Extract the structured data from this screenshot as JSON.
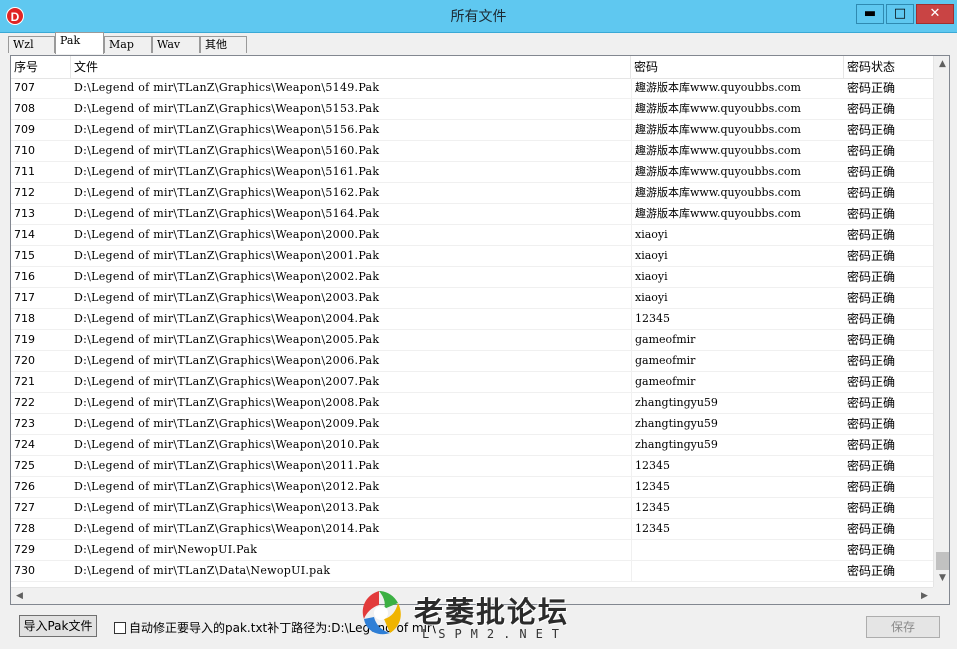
{
  "window": {
    "title": "所有文件",
    "app_icon_letter": "D",
    "min_glyph": "▬",
    "max_glyph": "□",
    "close_glyph": "✕"
  },
  "tabs": [
    {
      "label": "Wzl",
      "active": false
    },
    {
      "label": "Pak",
      "active": true
    },
    {
      "label": "Map",
      "active": false
    },
    {
      "label": "Wav",
      "active": false
    },
    {
      "label": "其他",
      "active": false
    }
  ],
  "table": {
    "columns": {
      "idx": "序号",
      "file": "文件",
      "pwd": "密码",
      "status": "密码状态"
    },
    "rows": [
      {
        "idx": "707",
        "file": "D:\\Legend of mir\\TLanZ\\Graphics\\Weapon\\5149.Pak",
        "pwd": "趣游版本库www.quyoubbs.com",
        "status": "密码正确"
      },
      {
        "idx": "708",
        "file": "D:\\Legend of mir\\TLanZ\\Graphics\\Weapon\\5153.Pak",
        "pwd": "趣游版本库www.quyoubbs.com",
        "status": "密码正确"
      },
      {
        "idx": "709",
        "file": "D:\\Legend of mir\\TLanZ\\Graphics\\Weapon\\5156.Pak",
        "pwd": "趣游版本库www.quyoubbs.com",
        "status": "密码正确"
      },
      {
        "idx": "710",
        "file": "D:\\Legend of mir\\TLanZ\\Graphics\\Weapon\\5160.Pak",
        "pwd": "趣游版本库www.quyoubbs.com",
        "status": "密码正确"
      },
      {
        "idx": "711",
        "file": "D:\\Legend of mir\\TLanZ\\Graphics\\Weapon\\5161.Pak",
        "pwd": "趣游版本库www.quyoubbs.com",
        "status": "密码正确"
      },
      {
        "idx": "712",
        "file": "D:\\Legend of mir\\TLanZ\\Graphics\\Weapon\\5162.Pak",
        "pwd": "趣游版本库www.quyoubbs.com",
        "status": "密码正确"
      },
      {
        "idx": "713",
        "file": "D:\\Legend of mir\\TLanZ\\Graphics\\Weapon\\5164.Pak",
        "pwd": "趣游版本库www.quyoubbs.com",
        "status": "密码正确"
      },
      {
        "idx": "714",
        "file": "D:\\Legend of mir\\TLanZ\\Graphics\\Weapon\\2000.Pak",
        "pwd": "xiaoyi",
        "status": "密码正确"
      },
      {
        "idx": "715",
        "file": "D:\\Legend of mir\\TLanZ\\Graphics\\Weapon\\2001.Pak",
        "pwd": "xiaoyi",
        "status": "密码正确"
      },
      {
        "idx": "716",
        "file": "D:\\Legend of mir\\TLanZ\\Graphics\\Weapon\\2002.Pak",
        "pwd": "xiaoyi",
        "status": "密码正确"
      },
      {
        "idx": "717",
        "file": "D:\\Legend of mir\\TLanZ\\Graphics\\Weapon\\2003.Pak",
        "pwd": "xiaoyi",
        "status": "密码正确"
      },
      {
        "idx": "718",
        "file": "D:\\Legend of mir\\TLanZ\\Graphics\\Weapon\\2004.Pak",
        "pwd": "12345",
        "status": "密码正确"
      },
      {
        "idx": "719",
        "file": "D:\\Legend of mir\\TLanZ\\Graphics\\Weapon\\2005.Pak",
        "pwd": "gameofmir",
        "status": "密码正确"
      },
      {
        "idx": "720",
        "file": "D:\\Legend of mir\\TLanZ\\Graphics\\Weapon\\2006.Pak",
        "pwd": "gameofmir",
        "status": "密码正确"
      },
      {
        "idx": "721",
        "file": "D:\\Legend of mir\\TLanZ\\Graphics\\Weapon\\2007.Pak",
        "pwd": "gameofmir",
        "status": "密码正确"
      },
      {
        "idx": "722",
        "file": "D:\\Legend of mir\\TLanZ\\Graphics\\Weapon\\2008.Pak",
        "pwd": "zhangtingyu59",
        "status": "密码正确"
      },
      {
        "idx": "723",
        "file": "D:\\Legend of mir\\TLanZ\\Graphics\\Weapon\\2009.Pak",
        "pwd": "zhangtingyu59",
        "status": "密码正确"
      },
      {
        "idx": "724",
        "file": "D:\\Legend of mir\\TLanZ\\Graphics\\Weapon\\2010.Pak",
        "pwd": "zhangtingyu59",
        "status": "密码正确"
      },
      {
        "idx": "725",
        "file": "D:\\Legend of mir\\TLanZ\\Graphics\\Weapon\\2011.Pak",
        "pwd": "12345",
        "status": "密码正确"
      },
      {
        "idx": "726",
        "file": "D:\\Legend of mir\\TLanZ\\Graphics\\Weapon\\2012.Pak",
        "pwd": "12345",
        "status": "密码正确"
      },
      {
        "idx": "727",
        "file": "D:\\Legend of mir\\TLanZ\\Graphics\\Weapon\\2013.Pak",
        "pwd": "12345",
        "status": "密码正确"
      },
      {
        "idx": "728",
        "file": "D:\\Legend of mir\\TLanZ\\Graphics\\Weapon\\2014.Pak",
        "pwd": "12345",
        "status": "密码正确"
      },
      {
        "idx": "729",
        "file": "D:\\Legend of mir\\NewopUI.Pak",
        "pwd": "",
        "status": "密码正确"
      },
      {
        "idx": "730",
        "file": "D:\\Legend of mir\\TLanZ\\Data\\NewopUI.pak",
        "pwd": "",
        "status": "密码正确"
      }
    ]
  },
  "scroll": {
    "up_glyph": "▲",
    "down_glyph": "▼",
    "left_glyph": "◀",
    "right_glyph": "▶"
  },
  "footer": {
    "import_label": "导入Pak文件",
    "auto_fix_label": "自动修正要导入的pak.txt补丁路径为:D:\\Legend of mir\\",
    "auto_fix_checked": false,
    "save_label": "保存"
  },
  "watermark": {
    "title": "老萎批论坛",
    "subtitle": "LSPM2.NET"
  }
}
